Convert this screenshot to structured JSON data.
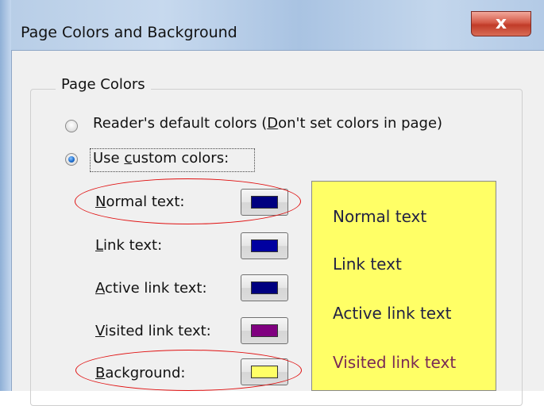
{
  "window": {
    "title": "Page Colors and Background",
    "close_glyph": "x"
  },
  "group": {
    "label": "Page Colors"
  },
  "options": {
    "default_colors": {
      "prefix": "Reader's default colors (",
      "mnemonic": "D",
      "suffix": "on't set colors in page)",
      "checked": false
    },
    "custom_colors": {
      "prefix": "Use ",
      "mnemonic": "c",
      "suffix": "ustom colors:",
      "checked": true
    }
  },
  "color_rows": [
    {
      "mnemonic": "N",
      "rest": "ormal text:",
      "swatch_color": "#000080"
    },
    {
      "mnemonic": "L",
      "rest": "ink text:",
      "swatch_color": "#0000a0"
    },
    {
      "mnemonic": "A",
      "rest": "ctive link text:",
      "swatch_color": "#000080"
    },
    {
      "mnemonic": "V",
      "rest": "isited link text:",
      "swatch_color": "#800080"
    },
    {
      "mnemonic": "B",
      "rest": "ackground:",
      "swatch_color": "#ffff66"
    }
  ],
  "preview": {
    "background": "#ffff66",
    "items": [
      {
        "text": "Normal text",
        "color": "#222244"
      },
      {
        "text": "Link text",
        "color": "#222244"
      },
      {
        "text": "Active link text",
        "color": "#222244"
      },
      {
        "text": "Visited link text",
        "color": "#7a2a55"
      }
    ]
  },
  "annotation_color": "#e01010"
}
